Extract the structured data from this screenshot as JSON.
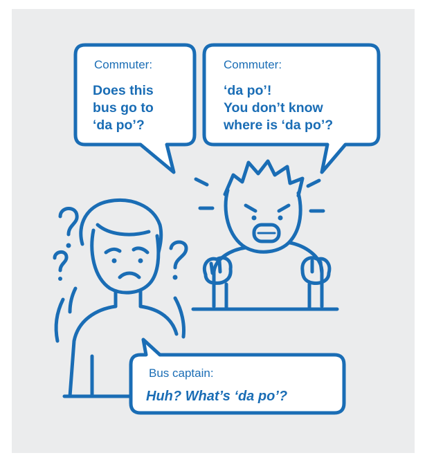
{
  "colors": {
    "panel_background": "#ebeced",
    "ink": "#1a6db5",
    "bubble_fill": "#ffffff"
  },
  "bubbles": {
    "left": {
      "speaker": "Commuter:",
      "lines": [
        "Does this",
        "bus go to",
        "‘da po’?"
      ]
    },
    "right": {
      "speaker": "Commuter:",
      "lines": [
        "‘da po’!",
        "You don’t know",
        "where is ‘da po’?"
      ]
    },
    "bottom": {
      "speaker": "Bus captain:",
      "lines": [
        "Huh? What’s ‘da po’?"
      ]
    }
  },
  "figures": {
    "confused_person": {
      "icon": "confused-person-icon",
      "marks": [
        "question-mark-icon",
        "question-mark-icon",
        "question-mark-icon"
      ]
    },
    "angry_person": {
      "icon": "angry-person-icon"
    }
  }
}
